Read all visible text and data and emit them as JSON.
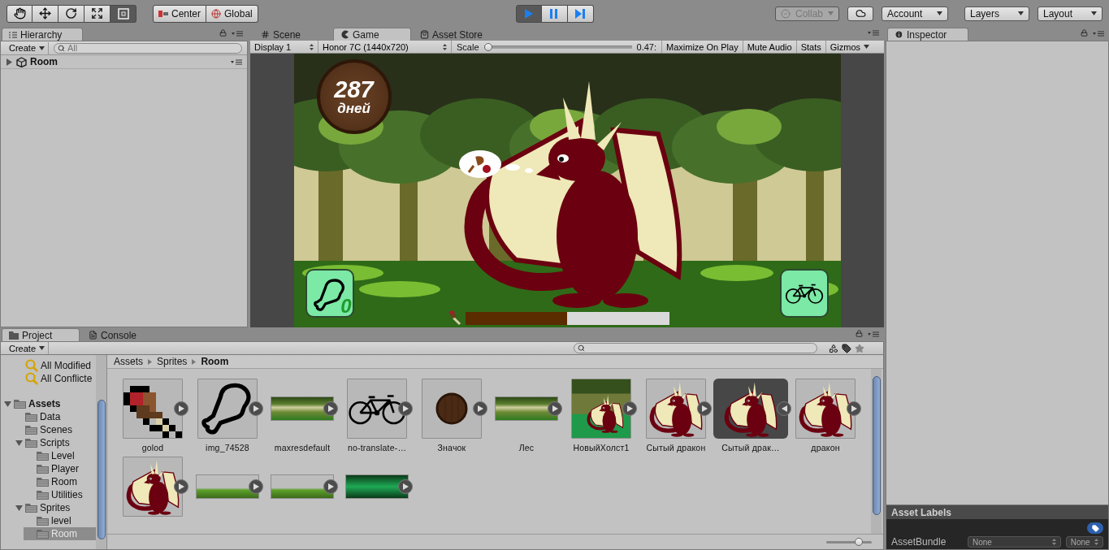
{
  "toolbar": {
    "tools": [
      {
        "kind": "hand",
        "selected": false
      },
      {
        "kind": "move",
        "selected": false
      },
      {
        "kind": "rotate",
        "selected": false
      },
      {
        "kind": "scale",
        "selected": false
      },
      {
        "kind": "rect",
        "selected": true
      }
    ],
    "pivot_mode": {
      "label": "Center"
    },
    "pivot_rotation": {
      "label": "Global"
    },
    "playback": [
      {
        "kind": "play",
        "on": true
      },
      {
        "kind": "pause",
        "on": false
      },
      {
        "kind": "step",
        "on": false
      }
    ],
    "collab": {
      "label": "Collab",
      "disabled": true
    },
    "account": {
      "label": "Account"
    },
    "layers": {
      "label": "Layers"
    },
    "layout": {
      "label": "Layout"
    }
  },
  "hierarchy": {
    "tab": "Hierarchy",
    "create": "Create",
    "search_placeholder": "All",
    "scene": {
      "name": "Room",
      "expanded": false
    }
  },
  "center_tabs": [
    {
      "label": "Scene",
      "kind": "scene",
      "selected": false
    },
    {
      "label": "Game",
      "kind": "game",
      "selected": true
    },
    {
      "label": "Asset Store",
      "kind": "store",
      "selected": false
    }
  ],
  "game_toolbar": {
    "display": "Display 1",
    "resolution": "Honor 7C (1440x720)",
    "scale_label": "Scale",
    "scale": {
      "level": 0
    },
    "scale_value": "0.47:",
    "toggles": [
      {
        "label": "Maximize On Play",
        "kind": "toggle",
        "on": false
      },
      {
        "label": "Mute Audio",
        "kind": "toggle",
        "on": false
      },
      {
        "label": "Stats",
        "kind": "toggle",
        "on": false
      },
      {
        "label": "Gizmos",
        "kind": "dropdown",
        "on": false
      }
    ]
  },
  "game": {
    "days": "287",
    "days_unit": "дней",
    "feed_count": "0",
    "hunger": {
      "level": 0.5
    }
  },
  "project": {
    "tabs": [
      {
        "label": "Project",
        "kind": "project",
        "selected": true
      },
      {
        "label": "Console",
        "kind": "console",
        "selected": false
      }
    ],
    "create": "Create",
    "tree": [
      {
        "name": "All Modified",
        "kind": "search",
        "selected": false
      },
      {
        "name": "All Conflicte",
        "kind": "search",
        "selected": false
      },
      {
        "name": "Assets",
        "kind": "root",
        "selected": false,
        "expanded": true,
        "children": [
          {
            "name": "Data",
            "kind": "folder",
            "selected": false
          },
          {
            "name": "Scenes",
            "kind": "folder",
            "selected": false
          },
          {
            "name": "Scripts",
            "kind": "folder",
            "selected": false,
            "expanded": true,
            "children": [
              {
                "name": "Level",
                "kind": "folder",
                "selected": false
              },
              {
                "name": "Player",
                "kind": "folder",
                "selected": false
              },
              {
                "name": "Room",
                "kind": "folder",
                "selected": false
              },
              {
                "name": "Utilities",
                "kind": "folder",
                "selected": false
              }
            ]
          },
          {
            "name": "Sprites",
            "kind": "folder",
            "selected": false,
            "expanded": true,
            "children": [
              {
                "name": "level",
                "kind": "folder",
                "selected": false
              },
              {
                "name": "Room",
                "kind": "folder",
                "selected": true
              }
            ]
          }
        ]
      }
    ],
    "breadcrumb": [
      "Assets",
      "Sprites",
      "Room"
    ],
    "assets": [
      {
        "name": "golod",
        "kind": "meat",
        "selected": false,
        "expanded": false
      },
      {
        "name": "img_74528",
        "kind": "drumstick",
        "selected": false,
        "expanded": false
      },
      {
        "name": "maxresdefault",
        "kind": "forest_strip",
        "selected": false,
        "expanded": false
      },
      {
        "name": "no-translate-…",
        "kind": "bike",
        "selected": false,
        "expanded": false
      },
      {
        "name": "Значок",
        "kind": "badge",
        "selected": false,
        "expanded": false
      },
      {
        "name": "Лес",
        "kind": "forest_strip",
        "selected": false,
        "expanded": false
      },
      {
        "name": "НовыйХолст1",
        "kind": "scene",
        "selected": false,
        "expanded": false
      },
      {
        "name": "Сытый дракон",
        "kind": "dragon",
        "selected": false,
        "expanded": false
      },
      {
        "name": "Сытый драк…",
        "kind": "dragon",
        "selected": true,
        "expanded": true
      },
      {
        "name": "дракон",
        "kind": "dragon",
        "selected": false,
        "expanded": false
      },
      {
        "kind": "dragon",
        "selected": false,
        "expanded": false
      },
      {
        "kind": "grass_strip",
        "selected": false,
        "expanded": false
      },
      {
        "kind": "grass_strip",
        "selected": false,
        "expanded": false
      },
      {
        "kind": "water_strip",
        "selected": false,
        "expanded": false
      }
    ],
    "zoom": {
      "level": 0.75
    }
  },
  "inspector": {
    "tab": "Inspector",
    "labels_title": "Asset Labels",
    "bundle_label": "AssetBundle",
    "bundle": "None",
    "variant": "None"
  }
}
